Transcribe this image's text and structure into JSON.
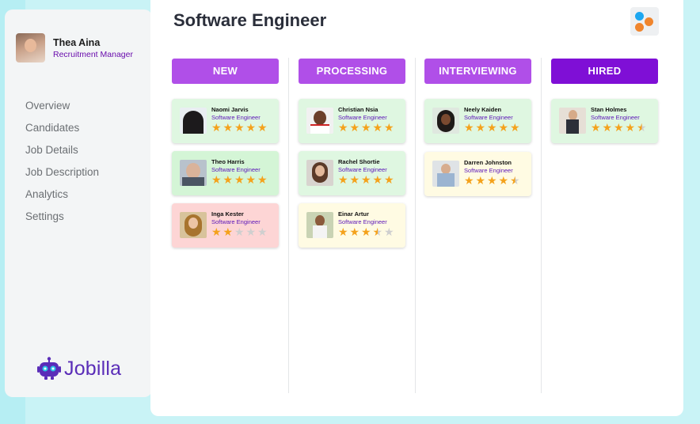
{
  "user": {
    "name": "Thea Aina",
    "role": "Recruitment Manager"
  },
  "nav": [
    {
      "label": "Overview"
    },
    {
      "label": "Candidates"
    },
    {
      "label": "Job Details"
    },
    {
      "label": "Job Description"
    },
    {
      "label": "Analytics"
    },
    {
      "label": "Settings"
    }
  ],
  "brand": {
    "name": "Jobilla",
    "color": "#5a2db8"
  },
  "page": {
    "title": "Software Engineer"
  },
  "colors": {
    "column_header": "#b04fe8",
    "column_header_hired": "#7f0fd6",
    "star": "#f4a21c",
    "role_text": "#5c16b8"
  },
  "columns": [
    {
      "label": "NEW"
    },
    {
      "label": "PROCESSING"
    },
    {
      "label": "INTERVIEWING"
    },
    {
      "label": "HIRED"
    }
  ],
  "candidates": [
    {
      "name": "Naomi Jarvis",
      "role": "Software Engineer",
      "rating": 5,
      "column": "NEW"
    },
    {
      "name": "Theo Harris",
      "role": "Software Engineer",
      "rating": 5,
      "column": "NEW"
    },
    {
      "name": "Inga Kester",
      "role": "Software Engineer",
      "rating": 2,
      "column": "NEW"
    },
    {
      "name": "Christian Nsia",
      "role": "Software Engineer",
      "rating": 5,
      "column": "PROCESSING"
    },
    {
      "name": "Rachel Shortie",
      "role": "Software Engineer",
      "rating": 5,
      "column": "PROCESSING"
    },
    {
      "name": "Einar Artur",
      "role": "Software Engineer",
      "rating": 3.5,
      "column": "PROCESSING"
    },
    {
      "name": "Neely Kaiden",
      "role": "Software Engineer",
      "rating": 5,
      "column": "INTERVIEWING"
    },
    {
      "name": "Darren Johnston",
      "role": "Software Engineer",
      "rating": 4.5,
      "column": "INTERVIEWING"
    },
    {
      "name": "Stan Holmes",
      "role": "Software Engineer",
      "rating": 4.5,
      "column": "HIRED"
    }
  ]
}
